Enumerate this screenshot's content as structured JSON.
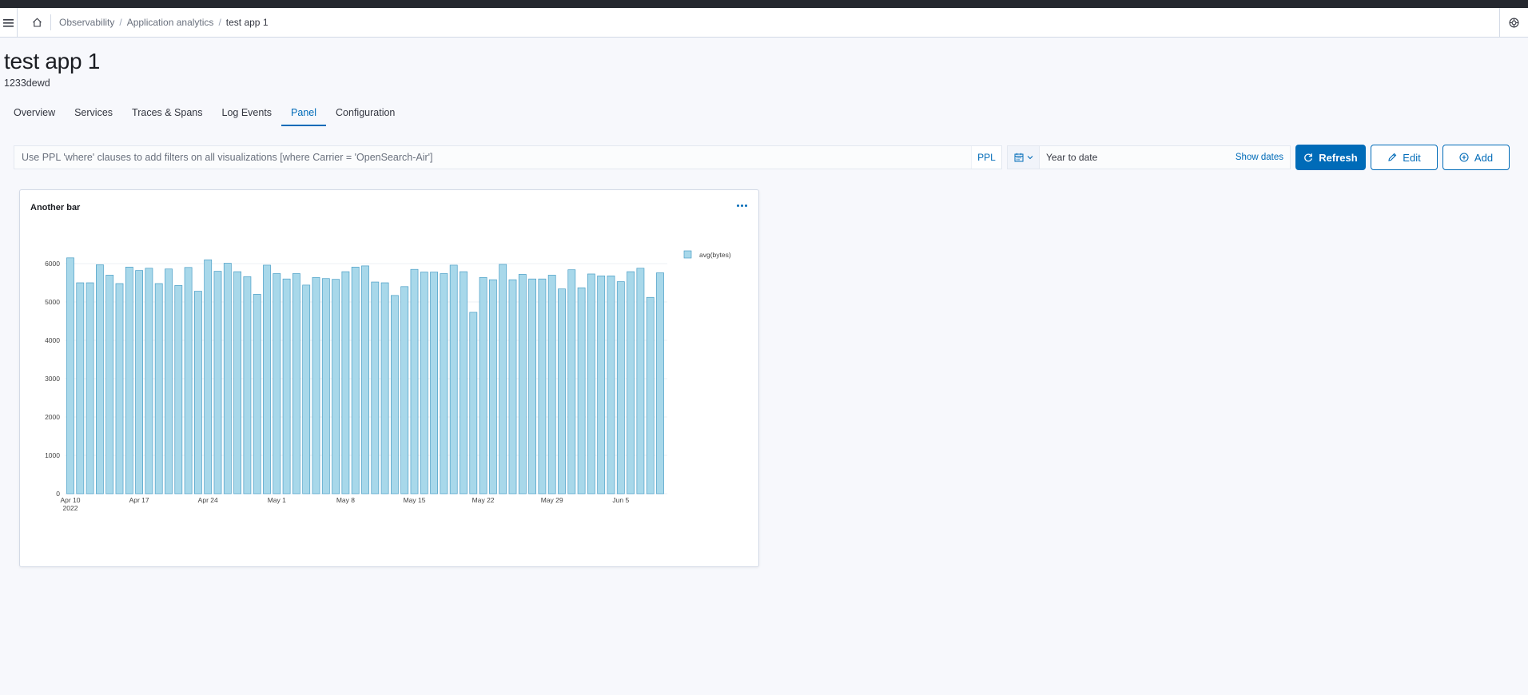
{
  "header": {
    "breadcrumbs": [
      "Observability",
      "Application analytics"
    ],
    "current": "test app 1"
  },
  "page": {
    "title": "test app 1",
    "subtitle": "1233dewd"
  },
  "tabs": [
    "Overview",
    "Services",
    "Traces & Spans",
    "Log Events",
    "Panel",
    "Configuration"
  ],
  "active_tab": "Panel",
  "filter": {
    "placeholder": "Use PPL 'where' clauses to add filters on all visualizations [where Carrier = 'OpenSearch-Air']",
    "ppl_label": "PPL"
  },
  "date_picker": {
    "range": "Year to date",
    "show_dates": "Show dates"
  },
  "buttons": {
    "refresh": "Refresh",
    "edit": "Edit",
    "add": "Add"
  },
  "icons": {
    "menu": "hamburger-icon",
    "home": "home-icon",
    "help": "help-icon",
    "calendar": "calendar-icon",
    "refresh": "refresh-icon",
    "edit": "pencil-icon",
    "add": "plus-circle-icon",
    "panel_menu": "ellipsis-icon"
  },
  "colors": {
    "accent": "#006bb8",
    "bar_fill": "#a8d8ea",
    "bar_stroke": "#4a9ec6"
  },
  "panel": {
    "title": "Another bar"
  },
  "chart_data": {
    "type": "bar",
    "title": "",
    "xlabel": "",
    "ylabel": "",
    "ylim": [
      0,
      6000
    ],
    "yticks": [
      0,
      1000,
      2000,
      3000,
      4000,
      5000,
      6000
    ],
    "x_start": "2022-04-10",
    "xticks": [
      {
        "label": "Apr 10",
        "sub": "2022",
        "date": "2022-04-10"
      },
      {
        "label": "Apr 17",
        "date": "2022-04-17"
      },
      {
        "label": "Apr 24",
        "date": "2022-04-24"
      },
      {
        "label": "May 1",
        "date": "2022-05-01"
      },
      {
        "label": "May 8",
        "date": "2022-05-08"
      },
      {
        "label": "May 15",
        "date": "2022-05-15"
      },
      {
        "label": "May 22",
        "date": "2022-05-22"
      },
      {
        "label": "May 29",
        "date": "2022-05-29"
      },
      {
        "label": "Jun 5",
        "date": "2022-06-05"
      }
    ],
    "grid": true,
    "legend_position": "top-right",
    "series": [
      {
        "name": "avg(bytes)",
        "values": [
          6150,
          5500,
          5500,
          5970,
          5700,
          5480,
          5910,
          5820,
          5880,
          5480,
          5860,
          5430,
          5900,
          5280,
          6100,
          5800,
          6010,
          5790,
          5660,
          5200,
          5960,
          5740,
          5600,
          5740,
          5440,
          5640,
          5610,
          5590,
          5790,
          5910,
          5940,
          5520,
          5500,
          5170,
          5400,
          5850,
          5780,
          5780,
          5740,
          5960,
          5790,
          4730,
          5640,
          5580,
          5980,
          5580,
          5720,
          5600,
          5600,
          5700,
          5340,
          5840,
          5370,
          5730,
          5680,
          5680,
          5530,
          5790,
          5880,
          5120,
          5760
        ]
      }
    ]
  }
}
